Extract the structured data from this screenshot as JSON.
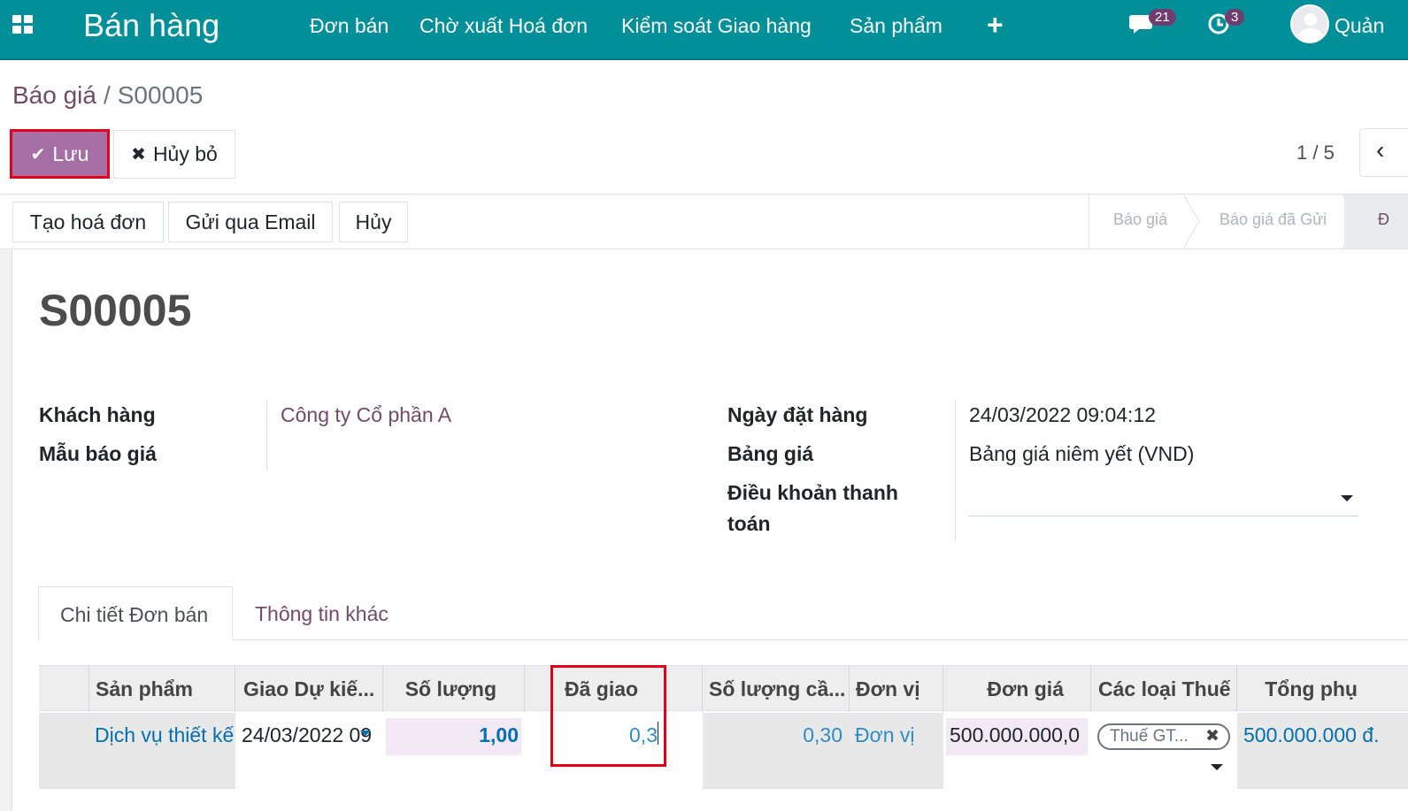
{
  "navbar": {
    "brand": "Bán hàng",
    "menu": [
      "Đơn bán",
      "Chờ xuất Hoá đơn",
      "Kiểm soát Giao hàng",
      "Sản phẩm"
    ],
    "plus_label": "+",
    "messages_count": "21",
    "activities_count": "3",
    "user_name": "Quản"
  },
  "breadcrumb": {
    "parent": "Báo giá",
    "separator": "/",
    "current": "S00005"
  },
  "control": {
    "save_label": "Lưu",
    "discard_label": "Hủy bỏ",
    "pager": "1 / 5"
  },
  "header_buttons": {
    "create_invoice": "Tạo hoá đơn",
    "send_email": "Gửi qua Email",
    "cancel": "Hủy"
  },
  "statusbar": {
    "steps": [
      "Báo giá",
      "Báo giá đã Gửi",
      "Đ"
    ]
  },
  "form": {
    "title": "S00005",
    "customer_label": "Khách hàng",
    "customer_value": "Công ty Cổ phần A",
    "template_label": "Mẫu báo giá",
    "order_date_label": "Ngày đặt hàng",
    "order_date_value": "24/03/2022 09:04:12",
    "pricelist_label": "Bảng giá",
    "pricelist_value": "Bảng giá niêm yết (VND)",
    "payment_terms_label_1": "Điều khoản thanh",
    "payment_terms_label_2": "toán"
  },
  "tabs": {
    "order_lines": "Chi tiết Đơn bán",
    "other_info": "Thông tin khác"
  },
  "table": {
    "headers": {
      "product": "Sản phẩm",
      "delivery_date": "Giao Dự kiế...",
      "quantity": "Số lượng",
      "delivered": "Đã giao",
      "to_invoice": "Số lượng cầ...",
      "uom": "Đơn vị",
      "unit_price": "Đơn giá",
      "taxes": "Các loại Thuế",
      "subtotal": "Tổng phụ"
    },
    "row": {
      "product": "Dịch vụ thiết kế",
      "delivery_date": "24/03/2022 09",
      "quantity": "1,00",
      "delivered": "0,3",
      "to_invoice": "0,30",
      "uom": "Đơn vị",
      "unit_price": "500.000.000,0",
      "tax": "Thuế GT...",
      "subtotal": "500.000.000 đ."
    }
  },
  "colors": {
    "navbar": "#018f9a",
    "primary": "#a56ea5",
    "link": "#714b67",
    "highlight": "#e2001a"
  }
}
